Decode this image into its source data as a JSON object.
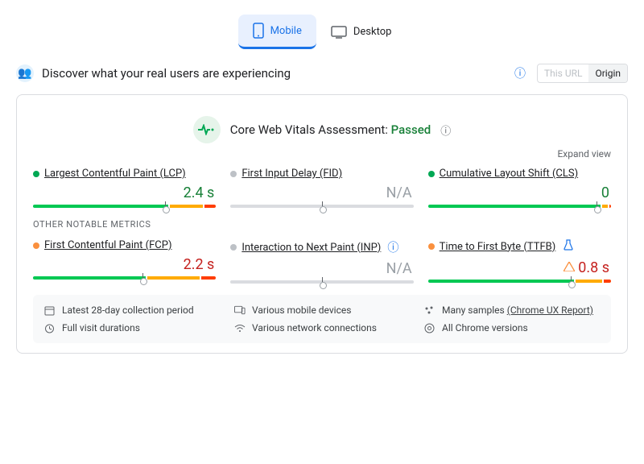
{
  "tabs": {
    "mobile": "Mobile",
    "desktop": "Desktop"
  },
  "header": {
    "title": "Discover what your real users are experiencing",
    "thisUrl": "This URL",
    "origin": "Origin"
  },
  "assessment": {
    "label": "Core Web Vitals Assessment:",
    "status": "Passed"
  },
  "expand": "Expand view",
  "section2": "OTHER NOTABLE METRICS",
  "metrics": {
    "lcp": {
      "name": "Largest Contentful Paint (LCP)",
      "value": "2.4 s",
      "status": "green",
      "marker": 72,
      "segs": [
        72,
        2,
        18,
        2,
        6
      ]
    },
    "fid": {
      "name": "First Input Delay (FID)",
      "value": "N/A",
      "status": "grey",
      "marker": 50
    },
    "cls": {
      "name": "Cumulative Layout Shift (CLS)",
      "value": "0",
      "status": "green",
      "marker": 92,
      "segs": [
        92,
        2,
        3,
        2,
        1
      ]
    },
    "fcp": {
      "name": "First Contentful Paint (FCP)",
      "value": "2.2 s",
      "status": "orange",
      "marker": 60,
      "segs": [
        60,
        2,
        28,
        2,
        8
      ]
    },
    "inp": {
      "name": "Interaction to Next Paint (INP)",
      "value": "N/A",
      "status": "grey",
      "marker": 50
    },
    "ttfb": {
      "name": "Time to First Byte (TTFB)",
      "value": "0.8 s",
      "status": "orange",
      "marker": 78,
      "segs": [
        78,
        2,
        14,
        2,
        4
      ]
    }
  },
  "footer": {
    "period": "Latest 28-day collection period",
    "devices": "Various mobile devices",
    "samples_a": "Many samples ",
    "samples_b": "(Chrome UX Report)",
    "durations": "Full visit durations",
    "network": "Various network connections",
    "versions": "All Chrome versions"
  }
}
